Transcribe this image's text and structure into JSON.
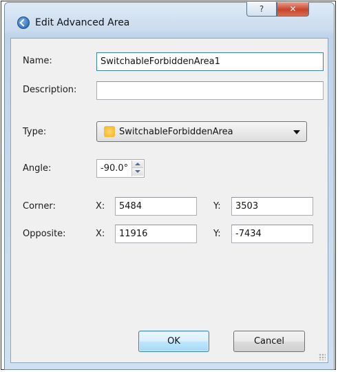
{
  "window": {
    "title": "Edit Advanced Area",
    "help_label": "?",
    "close_label": "✕"
  },
  "form": {
    "name_label": "Name:",
    "name_value": "SwitchableForbiddenArea1",
    "description_label": "Description:",
    "description_value": "",
    "type_label": "Type:",
    "type_value": "SwitchableForbiddenArea",
    "angle_label": "Angle:",
    "angle_value": "-90.0°",
    "corner_label": "Corner:",
    "corner_x_label": "X:",
    "corner_x_value": "5484",
    "corner_y_label": "Y:",
    "corner_y_value": "3503",
    "opposite_label": "Opposite:",
    "opposite_x_label": "X:",
    "opposite_x_value": "11916",
    "opposite_y_label": "Y:",
    "opposite_y_value": "-7434"
  },
  "buttons": {
    "ok_label": "OK",
    "cancel_label": "Cancel"
  },
  "icons": {
    "app": "app-refresh-icon",
    "type": "forbidden-area-type-icon"
  },
  "colors": {
    "accent_border": "#3c7fb1",
    "close_red": "#c9442a",
    "type_icon_yellow": "#f2b322"
  }
}
